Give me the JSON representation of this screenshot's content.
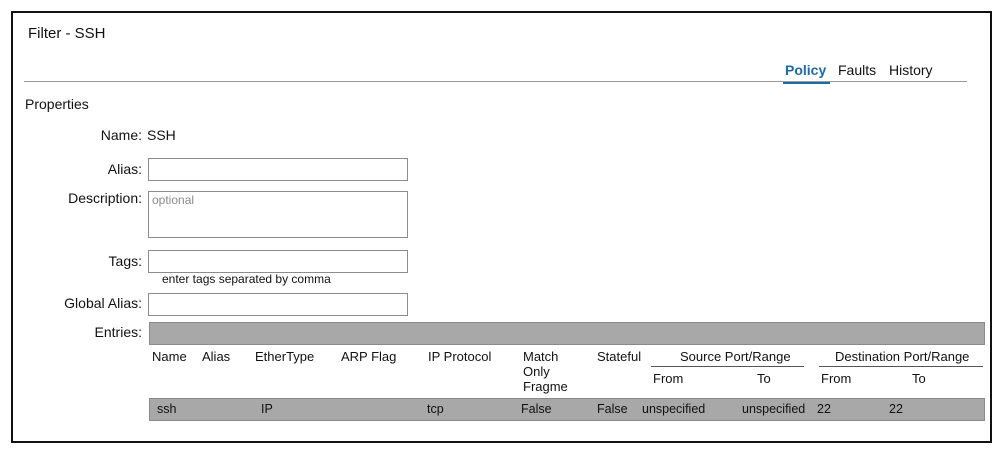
{
  "window": {
    "title": "Filter - SSH"
  },
  "tabs": [
    {
      "label": "Policy",
      "active": true
    },
    {
      "label": "Faults",
      "active": false
    },
    {
      "label": "History",
      "active": false
    }
  ],
  "properties": {
    "section_title": "Properties",
    "name_label": "Name:",
    "name_value": "SSH",
    "alias_label": "Alias:",
    "alias_value": "",
    "description_label": "Description:",
    "description_placeholder": "optional",
    "tags_label": "Tags:",
    "tags_value": "",
    "tags_hint": "enter tags separated by comma",
    "global_alias_label": "Global Alias:",
    "global_alias_value": "",
    "entries_label": "Entries:"
  },
  "entries_table": {
    "headers": {
      "name": "Name",
      "alias": "Alias",
      "ethertype": "EtherType",
      "arp_flag": "ARP Flag",
      "ip_protocol": "IP Protocol",
      "match_only_fragment": "Match Only Fragme",
      "stateful": "Stateful",
      "source_port_range": "Source Port/Range",
      "destination_port_range": "Destination Port/Range",
      "from": "From",
      "to": "To"
    },
    "rows": [
      {
        "name": "ssh",
        "alias": "",
        "ethertype": "IP",
        "arp_flag": "",
        "ip_protocol": "tcp",
        "match_only_fragment": "False",
        "stateful": "False",
        "source_from": "unspecified",
        "source_to": "unspecified",
        "destination_from": "22",
        "destination_to": "22"
      }
    ]
  },
  "colors": {
    "accent": "#1d6aa8",
    "table_row_bg": "#a8a8a8"
  }
}
